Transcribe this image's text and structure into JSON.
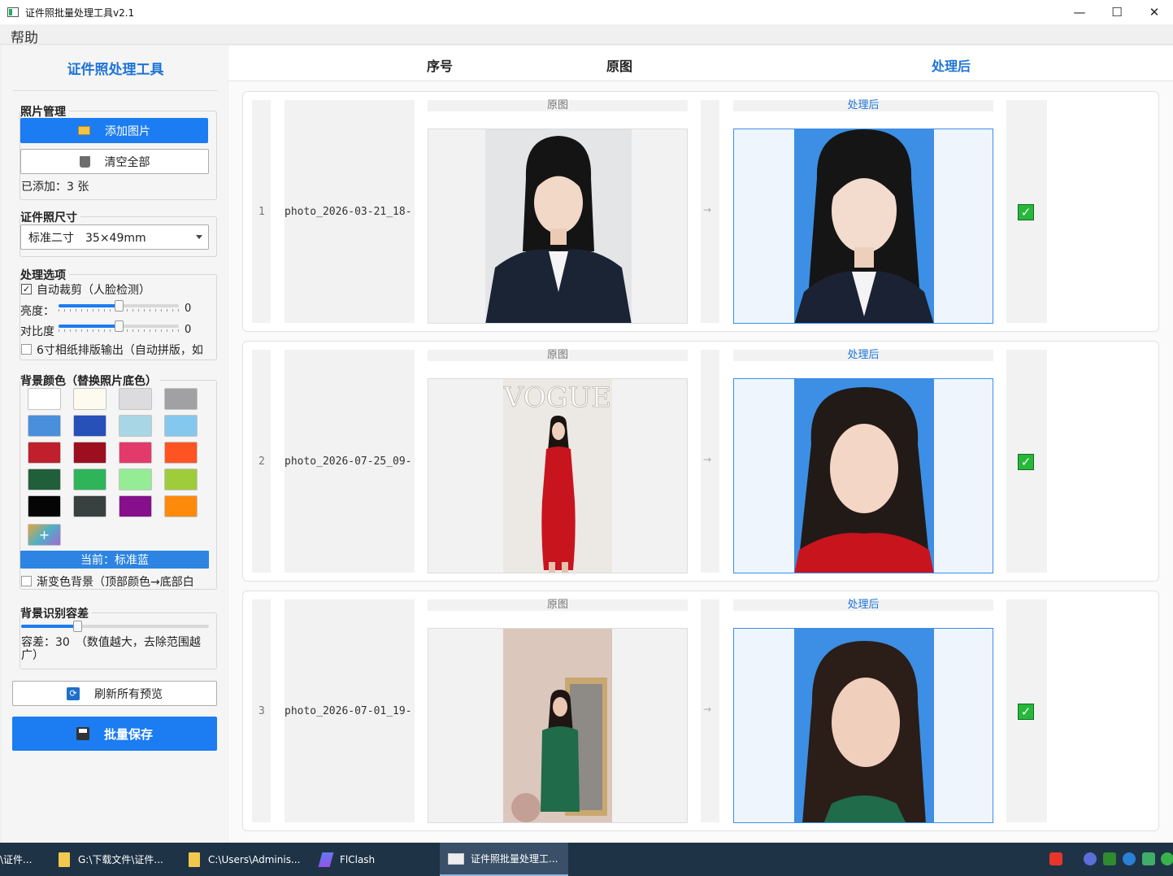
{
  "window": {
    "title": "证件照批量处理工具v2.1",
    "minimize": "—",
    "maximize": "☐",
    "close": "✕"
  },
  "menu": {
    "help": "帮助"
  },
  "sidebar": {
    "title": "证件照处理工具",
    "photo_group": {
      "label": "照片管理",
      "add_button": "添加图片",
      "clear_button": "清空全部",
      "count_text": "已添加：3 张"
    },
    "size_group": {
      "label": "证件照尺寸",
      "selected": "标准二寸　35×49mm"
    },
    "options_group": {
      "label": "处理选项",
      "auto_crop": "自动裁剪（人脸检测）",
      "auto_crop_checked": true,
      "brightness_label": "亮度：",
      "brightness_value": "0",
      "brightness_level": 0.5,
      "contrast_label": "对比度",
      "contrast_value": "0",
      "contrast_level": 0.5,
      "layout_print": "6寸相纸排版输出（自动拼版，如",
      "layout_print_checked": false
    },
    "bg_group": {
      "label": "背景颜色（替换照片底色）",
      "swatches": [
        "#ffffff",
        "#fdfaf0",
        "#dcdcdf",
        "#a1a1a4",
        "#4a8fdb",
        "#2751b8",
        "#a9d6e5",
        "#84c8ee",
        "#c01f2c",
        "#9d0f1f",
        "#e23a6b",
        "#fe5422",
        "#1f5f3a",
        "#2fb45a",
        "#94ec94",
        "#9fcc3a",
        "#050505",
        "#394040",
        "#860f8c",
        "#fe8a0b"
      ],
      "add_label": "+",
      "current": "当前：标准蓝",
      "gradient": "渐变色背景（顶部颜色→底部白",
      "gradient_checked": false
    },
    "tolerance_group": {
      "label": "背景识别容差",
      "value_text": "容差：30　（数值越大，去除范围越广）",
      "level": 0.3
    },
    "refresh_button": "刷新所有预览",
    "batch_save_button": "批量保存"
  },
  "table": {
    "headers": {
      "index": "序号",
      "original": "原图",
      "processed": "处理后"
    },
    "rows": [
      {
        "index": "1",
        "filename": "photo_2026-03-21_18-",
        "original_label": "原图",
        "processed_label": "处理后",
        "arrow": "→",
        "status": "✓"
      },
      {
        "index": "2",
        "filename": "photo_2026-07-25_09-",
        "original_label": "原图",
        "processed_label": "处理后",
        "arrow": "→",
        "status": "✓"
      },
      {
        "index": "3",
        "filename": "photo_2026-07-01_19-",
        "original_label": "原图",
        "processed_label": "处理后",
        "arrow": "→",
        "status": "✓"
      }
    ],
    "vogue_text": "VOGUE"
  },
  "taskbar": {
    "items": [
      "\\证件...",
      "G:\\下载文件\\证件...",
      "C:\\Users\\Adminis...",
      "FlClash",
      "证件照批量处理工..."
    ]
  },
  "colors": {
    "accent": "#1c7cf2",
    "bg_blue": "#3c8fe4",
    "ok_green": "#25b83a"
  }
}
